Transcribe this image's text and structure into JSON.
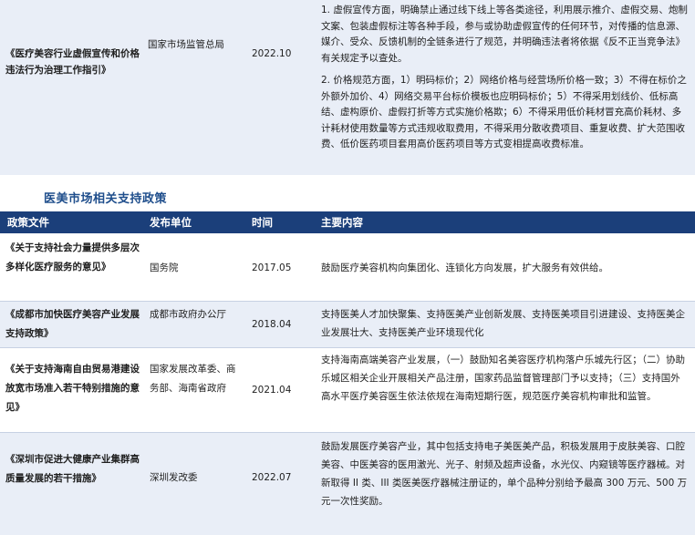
{
  "top_row": {
    "title": "《医疗美容行业虚假宣传和价格违法行为治理工作指引》",
    "unit": "国家市场监管总局",
    "date": "2022.10",
    "content_p1": "1. 虚假宣传方面，明确禁止通过线下线上等各类途径，利用展示推介、虚假交易、炮制文案、包装虚假标注等各种手段，参与或协助虚假宣传的任何环节，对传播的信息源、媒介、受众、反馈机制的全链条进行了规范，并明确违法者将依据《反不正当竞争法》有关规定予以查处。",
    "content_p2": "2. 价格规范方面，1）明码标价；2）网络价格与经营场所价格一致；3）不得在标价之外额外加价、4）网络交易平台标价模板也应明码标价；5）不得采用划线价、低标高结、虚构原价、虚假打折等方式实施价格欺；6）不得采用低价耗材冒充高价耗材、多计耗材使用数量等方式违规收取费用，不得采用分散收费项目、重复收费、扩大范围收费、低价医药项目套用高价医药项目等方式变相提高收费标准。"
  },
  "section_title": "医美市场相关支持政策",
  "table": {
    "headers": [
      "政策文件",
      "发布单位",
      "时间",
      "主要内容"
    ],
    "rows": [
      {
        "doc": "《关于支持社会力量提供多层次多样化医疗服务的意见》",
        "unit": "国务院",
        "date": "2017.05",
        "content": "鼓励医疗美容机构向集团化、连锁化方向发展，扩大服务有效供给。"
      },
      {
        "doc": "《成都市加快医疗美容产业发展支持政策》",
        "unit": "成都市政府办公厅",
        "date": "2018.04",
        "content": "支持医美人才加快聚集、支持医美产业创新发展、支持医美项目引进建设、支持医美企业发展壮大、支持医美产业环境现代化"
      },
      {
        "doc": "《关于支持海南自由贸易港建设放宽市场准入若干特别措施的意见》",
        "unit": "国家发展改革委、商务部、海南省政府",
        "date": "2021.04",
        "content": "支持海南高端美容产业发展，（一）鼓励知名美容医疗机构落户乐城先行区；（二）协助乐城区相关企业开展相关产品注册，国家药品监督管理部门予以支持；（三）支持国外高水平医疗美容医生依法依规在海南短期行医，规范医疗美容机构审批和监管。"
      },
      {
        "doc": "《深圳市促进大健康产业集群高质量发展的若干措施》",
        "unit": "深圳发改委",
        "date": "2022.07",
        "content": "鼓励发展医疗美容产业，其中包括支持电子美医美产品，积极发展用于皮肤美容、口腔美容、中医美容的医用激光、光子、射频及超声设备，水光仪、内窥镜等医疗器械。对新取得 II 类、III 类医美医疗器械注册证的，单个品种分别给予最高 300 万元、500 万元一次性奖励。"
      }
    ]
  }
}
